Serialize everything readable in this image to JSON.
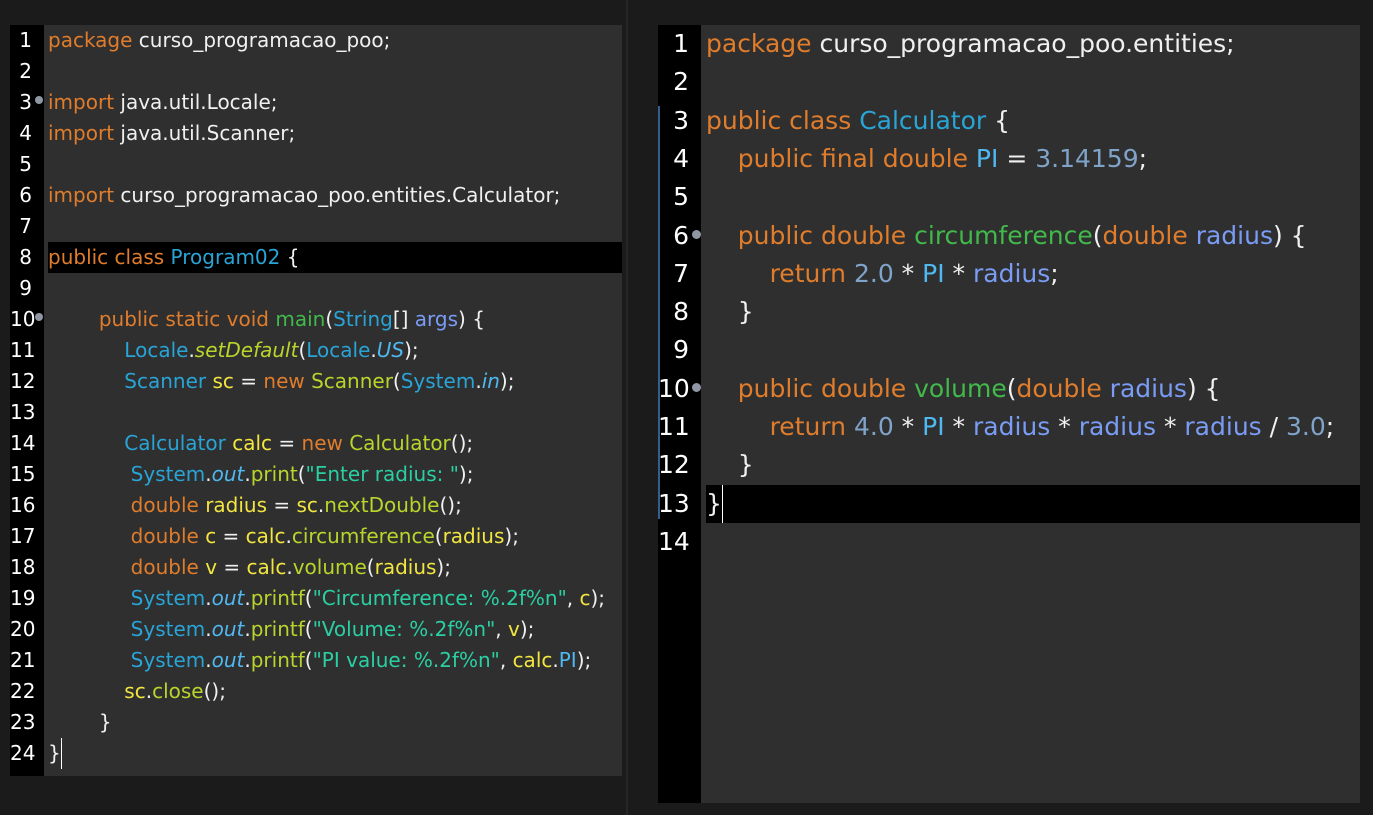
{
  "colors": {
    "background": "#1b1b1b",
    "editor_background": "#2f2f2f",
    "gutter_background": "#000000",
    "current_line": "#000000",
    "keyword": "#e07d2c",
    "class_name": "#29a4d6",
    "method_declaration": "#41b94b",
    "method_call": "#b8d52c",
    "local_variable": "#f2e540",
    "parameter": "#7a9cf5",
    "number": "#7fa3c9",
    "string": "#2ad0a3",
    "field": "#4fb8f0",
    "plain": "#f0f0f0"
  },
  "left_editor": {
    "current_line": 8,
    "lines": [
      {
        "n": "1",
        "tokens": [
          {
            "t": "package",
            "c": "kw"
          },
          {
            "t": " curso_programacao_poo;",
            "c": "pl"
          }
        ]
      },
      {
        "n": "2",
        "tokens": []
      },
      {
        "n": "3",
        "marker": true,
        "tokens": [
          {
            "t": "import",
            "c": "kw"
          },
          {
            "t": " java.util.Locale;",
            "c": "pl"
          }
        ]
      },
      {
        "n": "4",
        "tokens": [
          {
            "t": "import",
            "c": "kw"
          },
          {
            "t": " java.util.Scanner;",
            "c": "pl"
          }
        ]
      },
      {
        "n": "5",
        "tokens": []
      },
      {
        "n": "6",
        "tokens": [
          {
            "t": "import",
            "c": "kw"
          },
          {
            "t": " curso_programacao_poo.entities.Calculator;",
            "c": "pl"
          }
        ]
      },
      {
        "n": "7",
        "tokens": []
      },
      {
        "n": "8",
        "tokens": [
          {
            "t": "public class ",
            "c": "kw"
          },
          {
            "t": "Program02",
            "c": "cls"
          },
          {
            "t": " {",
            "c": "pl"
          }
        ]
      },
      {
        "n": "9",
        "tokens": []
      },
      {
        "n": "10",
        "marker": true,
        "tokens": [
          {
            "t": "        ",
            "c": "pl"
          },
          {
            "t": "public static void ",
            "c": "kw"
          },
          {
            "t": "main",
            "c": "fn"
          },
          {
            "t": "(",
            "c": "pl"
          },
          {
            "t": "String",
            "c": "cls"
          },
          {
            "t": "[] ",
            "c": "pl"
          },
          {
            "t": "args",
            "c": "param"
          },
          {
            "t": ") {",
            "c": "pl"
          }
        ]
      },
      {
        "n": "11",
        "tokens": [
          {
            "t": "            ",
            "c": "pl"
          },
          {
            "t": "Locale",
            "c": "cls"
          },
          {
            "t": ".",
            "c": "pl"
          },
          {
            "t": "setDefault",
            "c": "fnc it"
          },
          {
            "t": "(",
            "c": "pl"
          },
          {
            "t": "Locale",
            "c": "cls"
          },
          {
            "t": ".",
            "c": "pl"
          },
          {
            "t": "US",
            "c": "cnst it"
          },
          {
            "t": ");",
            "c": "pl"
          }
        ]
      },
      {
        "n": "12",
        "tokens": [
          {
            "t": "            ",
            "c": "pl"
          },
          {
            "t": "Scanner",
            "c": "cls"
          },
          {
            "t": " ",
            "c": "pl"
          },
          {
            "t": "sc",
            "c": "var"
          },
          {
            "t": " = ",
            "c": "pl"
          },
          {
            "t": "new",
            "c": "kw"
          },
          {
            "t": " ",
            "c": "pl"
          },
          {
            "t": "Scanner",
            "c": "fnc"
          },
          {
            "t": "(",
            "c": "pl"
          },
          {
            "t": "System",
            "c": "cls"
          },
          {
            "t": ".",
            "c": "pl"
          },
          {
            "t": "in",
            "c": "cnst it"
          },
          {
            "t": ");",
            "c": "pl"
          }
        ]
      },
      {
        "n": "13",
        "tokens": []
      },
      {
        "n": "14",
        "tokens": [
          {
            "t": "            ",
            "c": "pl"
          },
          {
            "t": "Calculator",
            "c": "cls"
          },
          {
            "t": " ",
            "c": "pl"
          },
          {
            "t": "calc",
            "c": "var"
          },
          {
            "t": " = ",
            "c": "pl"
          },
          {
            "t": "new",
            "c": "kw"
          },
          {
            "t": " ",
            "c": "pl"
          },
          {
            "t": "Calculator",
            "c": "fnc"
          },
          {
            "t": "();",
            "c": "pl"
          }
        ]
      },
      {
        "n": "15",
        "tokens": [
          {
            "t": "             ",
            "c": "pl"
          },
          {
            "t": "System",
            "c": "cls"
          },
          {
            "t": ".",
            "c": "pl"
          },
          {
            "t": "out",
            "c": "cnst it"
          },
          {
            "t": ".",
            "c": "pl"
          },
          {
            "t": "print",
            "c": "fnc"
          },
          {
            "t": "(",
            "c": "pl"
          },
          {
            "t": "\"Enter radius: \"",
            "c": "str"
          },
          {
            "t": ");",
            "c": "pl"
          }
        ]
      },
      {
        "n": "16",
        "tokens": [
          {
            "t": "             ",
            "c": "pl"
          },
          {
            "t": "double ",
            "c": "kw"
          },
          {
            "t": "radius",
            "c": "var"
          },
          {
            "t": " = ",
            "c": "pl"
          },
          {
            "t": "sc",
            "c": "var"
          },
          {
            "t": ".",
            "c": "pl"
          },
          {
            "t": "nextDouble",
            "c": "fnc"
          },
          {
            "t": "();",
            "c": "pl"
          }
        ]
      },
      {
        "n": "17",
        "tokens": [
          {
            "t": "             ",
            "c": "pl"
          },
          {
            "t": "double ",
            "c": "kw"
          },
          {
            "t": "c",
            "c": "var"
          },
          {
            "t": " = ",
            "c": "pl"
          },
          {
            "t": "calc",
            "c": "var"
          },
          {
            "t": ".",
            "c": "pl"
          },
          {
            "t": "circumference",
            "c": "fnc"
          },
          {
            "t": "(",
            "c": "pl"
          },
          {
            "t": "radius",
            "c": "var"
          },
          {
            "t": ");",
            "c": "pl"
          }
        ]
      },
      {
        "n": "18",
        "tokens": [
          {
            "t": "             ",
            "c": "pl"
          },
          {
            "t": "double ",
            "c": "kw"
          },
          {
            "t": "v",
            "c": "var"
          },
          {
            "t": " = ",
            "c": "pl"
          },
          {
            "t": "calc",
            "c": "var"
          },
          {
            "t": ".",
            "c": "pl"
          },
          {
            "t": "volume",
            "c": "fnc"
          },
          {
            "t": "(",
            "c": "pl"
          },
          {
            "t": "radius",
            "c": "var"
          },
          {
            "t": ");",
            "c": "pl"
          }
        ]
      },
      {
        "n": "19",
        "tokens": [
          {
            "t": "             ",
            "c": "pl"
          },
          {
            "t": "System",
            "c": "cls"
          },
          {
            "t": ".",
            "c": "pl"
          },
          {
            "t": "out",
            "c": "cnst it"
          },
          {
            "t": ".",
            "c": "pl"
          },
          {
            "t": "printf",
            "c": "fnc"
          },
          {
            "t": "(",
            "c": "pl"
          },
          {
            "t": "\"Circumference: %.2f%n\"",
            "c": "str"
          },
          {
            "t": ", ",
            "c": "pl"
          },
          {
            "t": "c",
            "c": "var"
          },
          {
            "t": ");",
            "c": "pl"
          }
        ]
      },
      {
        "n": "20",
        "tokens": [
          {
            "t": "             ",
            "c": "pl"
          },
          {
            "t": "System",
            "c": "cls"
          },
          {
            "t": ".",
            "c": "pl"
          },
          {
            "t": "out",
            "c": "cnst it"
          },
          {
            "t": ".",
            "c": "pl"
          },
          {
            "t": "printf",
            "c": "fnc"
          },
          {
            "t": "(",
            "c": "pl"
          },
          {
            "t": "\"Volume: %.2f%n\"",
            "c": "str"
          },
          {
            "t": ", ",
            "c": "pl"
          },
          {
            "t": "v",
            "c": "var"
          },
          {
            "t": ");",
            "c": "pl"
          }
        ]
      },
      {
        "n": "21",
        "tokens": [
          {
            "t": "             ",
            "c": "pl"
          },
          {
            "t": "System",
            "c": "cls"
          },
          {
            "t": ".",
            "c": "pl"
          },
          {
            "t": "out",
            "c": "cnst it"
          },
          {
            "t": ".",
            "c": "pl"
          },
          {
            "t": "printf",
            "c": "fnc"
          },
          {
            "t": "(",
            "c": "pl"
          },
          {
            "t": "\"PI value: %.2f%n\"",
            "c": "str"
          },
          {
            "t": ", ",
            "c": "pl"
          },
          {
            "t": "calc",
            "c": "var"
          },
          {
            "t": ".",
            "c": "pl"
          },
          {
            "t": "PI",
            "c": "cnst"
          },
          {
            "t": ");",
            "c": "pl"
          }
        ]
      },
      {
        "n": "22",
        "tokens": [
          {
            "t": "            ",
            "c": "pl"
          },
          {
            "t": "sc",
            "c": "var"
          },
          {
            "t": ".",
            "c": "pl"
          },
          {
            "t": "close",
            "c": "fnc"
          },
          {
            "t": "();",
            "c": "pl"
          }
        ]
      },
      {
        "n": "23",
        "tokens": [
          {
            "t": "        }",
            "c": "pl"
          }
        ]
      },
      {
        "n": "24",
        "cursor": true,
        "tokens": [
          {
            "t": "}",
            "c": "pl"
          }
        ]
      }
    ]
  },
  "right_editor": {
    "current_line": 13,
    "lines": [
      {
        "n": "1",
        "tokens": [
          {
            "t": "package",
            "c": "kw"
          },
          {
            "t": " curso_programacao_poo.entities;",
            "c": "pl"
          }
        ]
      },
      {
        "n": "2",
        "tokens": []
      },
      {
        "n": "3",
        "tokens": [
          {
            "t": "public class ",
            "c": "kw"
          },
          {
            "t": "Calculator",
            "c": "cls"
          },
          {
            "t": " {",
            "c": "pl"
          }
        ]
      },
      {
        "n": "4",
        "tokens": [
          {
            "t": "    ",
            "c": "pl"
          },
          {
            "t": "public final double ",
            "c": "kw"
          },
          {
            "t": "PI",
            "c": "cnst"
          },
          {
            "t": " = ",
            "c": "pl"
          },
          {
            "t": "3.14159",
            "c": "num"
          },
          {
            "t": ";",
            "c": "pl"
          }
        ]
      },
      {
        "n": "5",
        "tokens": []
      },
      {
        "n": "6",
        "marker": true,
        "tokens": [
          {
            "t": "    ",
            "c": "pl"
          },
          {
            "t": "public double ",
            "c": "kw"
          },
          {
            "t": "circumference",
            "c": "fn"
          },
          {
            "t": "(",
            "c": "pl"
          },
          {
            "t": "double ",
            "c": "kw"
          },
          {
            "t": "radius",
            "c": "param"
          },
          {
            "t": ") {",
            "c": "pl"
          }
        ]
      },
      {
        "n": "7",
        "tokens": [
          {
            "t": "        ",
            "c": "pl"
          },
          {
            "t": "return ",
            "c": "kw"
          },
          {
            "t": "2.0",
            "c": "num"
          },
          {
            "t": " * ",
            "c": "pl"
          },
          {
            "t": "PI",
            "c": "cnst"
          },
          {
            "t": " * ",
            "c": "pl"
          },
          {
            "t": "radius",
            "c": "param"
          },
          {
            "t": ";",
            "c": "pl"
          }
        ]
      },
      {
        "n": "8",
        "tokens": [
          {
            "t": "    }",
            "c": "pl"
          }
        ]
      },
      {
        "n": "9",
        "tokens": []
      },
      {
        "n": "10",
        "marker": true,
        "tokens": [
          {
            "t": "    ",
            "c": "pl"
          },
          {
            "t": "public double ",
            "c": "kw"
          },
          {
            "t": "volume",
            "c": "fn"
          },
          {
            "t": "(",
            "c": "pl"
          },
          {
            "t": "double ",
            "c": "kw"
          },
          {
            "t": "radius",
            "c": "param"
          },
          {
            "t": ") {",
            "c": "pl"
          }
        ]
      },
      {
        "n": "11",
        "tokens": [
          {
            "t": "        ",
            "c": "pl"
          },
          {
            "t": "return ",
            "c": "kw"
          },
          {
            "t": "4.0",
            "c": "num"
          },
          {
            "t": " * ",
            "c": "pl"
          },
          {
            "t": "PI",
            "c": "cnst"
          },
          {
            "t": " * ",
            "c": "pl"
          },
          {
            "t": "radius",
            "c": "param"
          },
          {
            "t": " * ",
            "c": "pl"
          },
          {
            "t": "radius",
            "c": "param"
          },
          {
            "t": " * ",
            "c": "pl"
          },
          {
            "t": "radius",
            "c": "param"
          },
          {
            "t": " / ",
            "c": "pl"
          },
          {
            "t": "3.0",
            "c": "num"
          },
          {
            "t": ";",
            "c": "pl"
          }
        ]
      },
      {
        "n": "12",
        "tokens": [
          {
            "t": "    }",
            "c": "pl"
          }
        ]
      },
      {
        "n": "13",
        "cursor": true,
        "tokens": [
          {
            "t": "}",
            "c": "pl"
          }
        ]
      },
      {
        "n": "14",
        "tokens": []
      }
    ]
  }
}
